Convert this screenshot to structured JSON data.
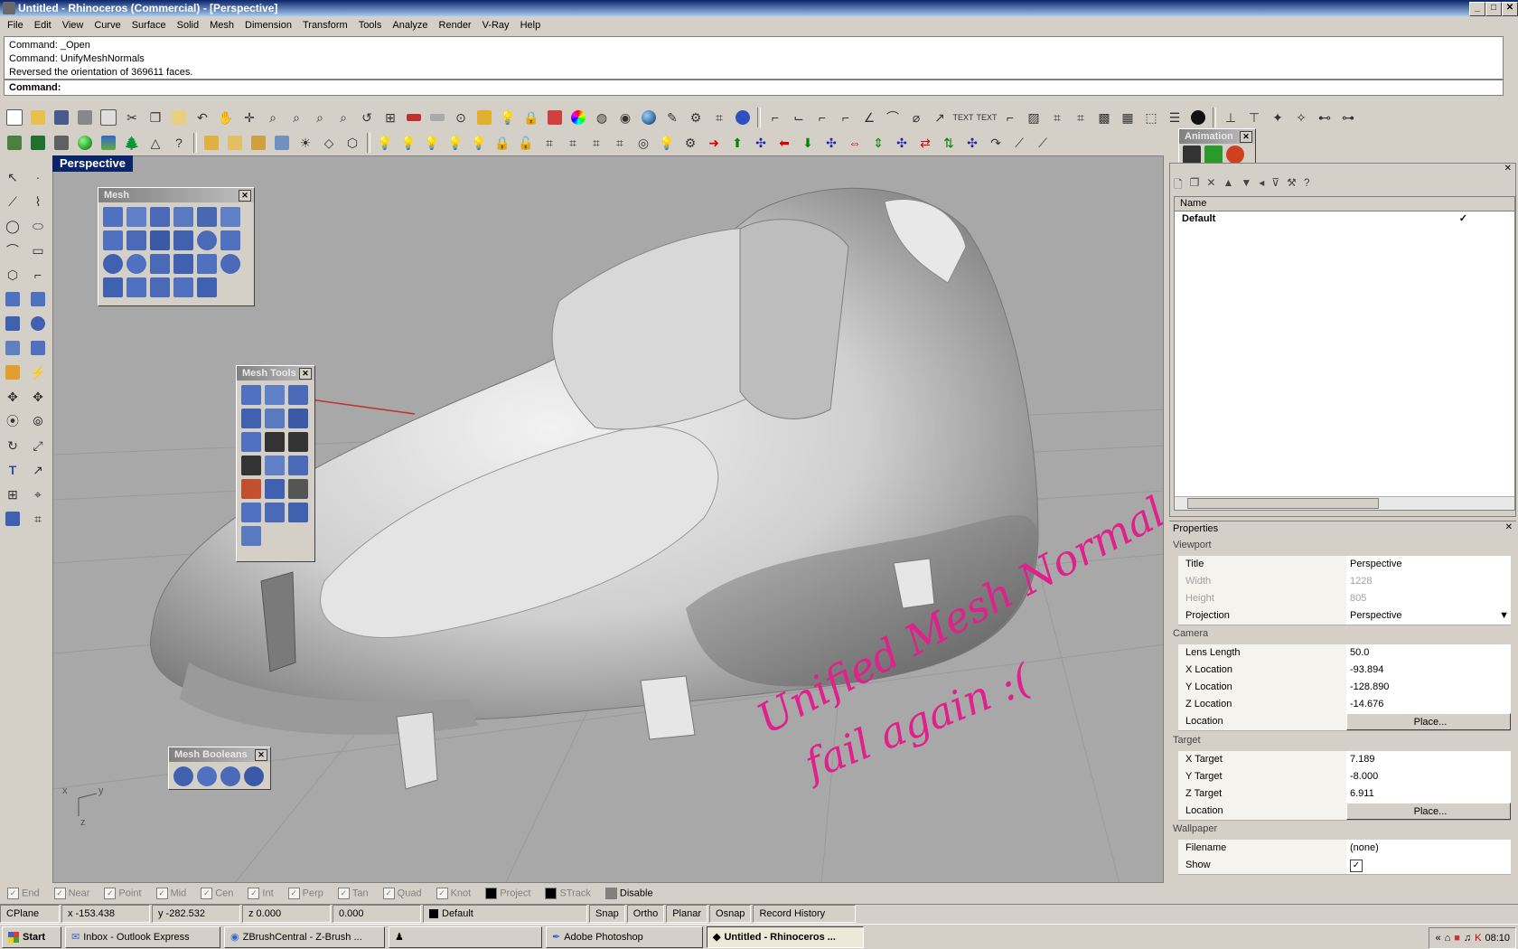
{
  "window": {
    "title": "Untitled - Rhinoceros (Commercial) - [Perspective]",
    "min": "_",
    "max": "□",
    "close": "✕"
  },
  "menu": [
    "File",
    "Edit",
    "View",
    "Curve",
    "Surface",
    "Solid",
    "Mesh",
    "Dimension",
    "Transform",
    "Tools",
    "Analyze",
    "Render",
    "V-Ray",
    "Help"
  ],
  "command": {
    "history": [
      "Command: _Open",
      "Command: UnifyMeshNormals",
      "Reversed the orientation of 369611 faces."
    ],
    "prompt": "Command:"
  },
  "toolbar": {
    "text1": "TEXT",
    "text2": "TEXT"
  },
  "viewport": {
    "title": "Perspective",
    "axis_x": "x",
    "axis_y": "y",
    "axis_z": "z",
    "handwriting_line1": "Unified Mesh Normals",
    "handwriting_line2": "fail again :(",
    "handwriting_color": "#e0208c"
  },
  "panels": {
    "mesh": "Mesh",
    "mesh_tools": "Mesh Tools",
    "mesh_booleans": "Mesh Booleans",
    "animation": "Animation"
  },
  "layers": {
    "col_name": "Name",
    "rows": [
      {
        "name": "Default",
        "check": "✓"
      }
    ]
  },
  "properties": {
    "title": "Properties",
    "section_viewport": "Viewport",
    "section_camera": "Camera",
    "section_target": "Target",
    "section_wallpaper": "Wallpaper",
    "rows": [
      {
        "key": "Title",
        "value": "Perspective"
      },
      {
        "key": "Width",
        "value": "1228"
      },
      {
        "key": "Height",
        "value": "805"
      },
      {
        "key": "Projection",
        "value": "Perspective"
      },
      {
        "key": "Lens Length",
        "value": "50.0"
      },
      {
        "key": "X Location",
        "value": "-93.894"
      },
      {
        "key": "Y Location",
        "value": "-128.890"
      },
      {
        "key": "Z Location",
        "value": "-14.676"
      },
      {
        "key": "Location",
        "value": "Place..."
      },
      {
        "key": "X Target",
        "value": "7.189"
      },
      {
        "key": "Y Target",
        "value": "-8.000"
      },
      {
        "key": "Z Target",
        "value": "6.911"
      },
      {
        "key": "Location",
        "value": "Place..."
      },
      {
        "key": "Filename",
        "value": "(none)"
      },
      {
        "key": "Show",
        "value": "✓"
      }
    ]
  },
  "osnap": [
    "End",
    "Near",
    "Point",
    "Mid",
    "Cen",
    "Int",
    "Perp",
    "Tan",
    "Quad",
    "Knot",
    "Project",
    "STrack",
    "Disable"
  ],
  "status": {
    "cplane": "CPlane",
    "x": "x -153.438",
    "y": "y -282.532",
    "z": "z 0.000",
    "d": "0.000",
    "layer": "Default",
    "snap": "Snap",
    "ortho": "Ortho",
    "planar": "Planar",
    "osnap": "Osnap",
    "history": "Record History"
  },
  "taskbar": {
    "start": "Start",
    "items": [
      "Inbox - Outlook Express",
      "ZBrushCentral - Z-Brush ...",
      "",
      "Adobe Photoshop",
      "Untitled - Rhinoceros ..."
    ],
    "clock": "08:10"
  }
}
